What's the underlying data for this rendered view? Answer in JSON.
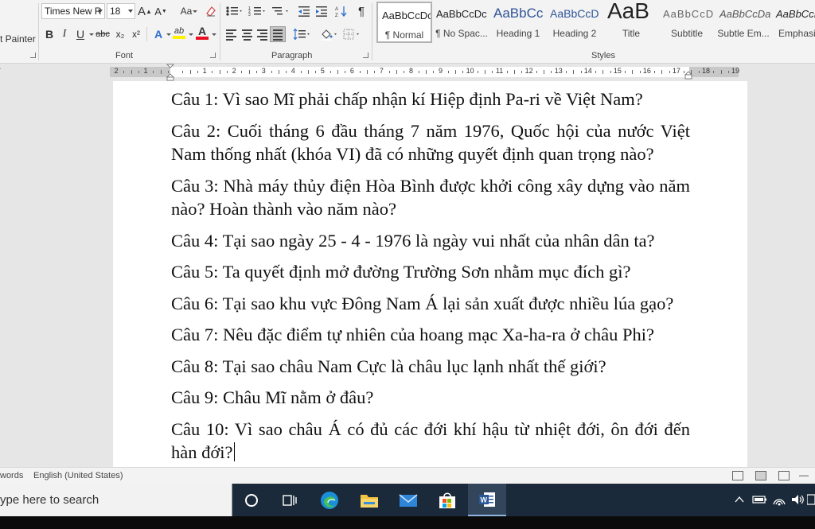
{
  "ribbon": {
    "format_painter_label": "t Painter",
    "font_group": {
      "label": "Font",
      "font_name": "Times New R",
      "font_size": "18",
      "grow_label": "A",
      "shrink_label": "A",
      "case_label": "Aa",
      "bold": "B",
      "italic": "I",
      "underline": "U",
      "strike": "abc",
      "subscript": "x₂",
      "superscript": "x²",
      "text_effects": "A",
      "highlight": "ab",
      "font_color": "A",
      "font_color_hex": "#e81123",
      "highlight_hex": "#fff200"
    },
    "paragraph_group": {
      "label": "Paragraph",
      "pilcrow": "¶"
    },
    "styles_group": {
      "label": "Styles",
      "items": [
        {
          "sample": "AaBbCcDc",
          "name": "¶ Normal",
          "selected": true
        },
        {
          "sample": "AaBbCcDc",
          "name": "¶ No Spac..."
        },
        {
          "sample": "AaBbCc",
          "name": "Heading 1"
        },
        {
          "sample": "AaBbCcD",
          "name": "Heading 2"
        },
        {
          "sample": "AaB",
          "name": "Title"
        },
        {
          "sample": "AaBbCcD",
          "name": "Subtitle"
        },
        {
          "sample": "AaBbCcDa",
          "name": "Subtle Em..."
        },
        {
          "sample": "AaBbCcD",
          "name": "Emphasi"
        }
      ]
    }
  },
  "ruler": {
    "numbers": [
      "2",
      "1",
      "",
      "1",
      "2",
      "3",
      "4",
      "5",
      "6",
      "7",
      "8",
      "9",
      "10",
      "11",
      "12",
      "13",
      "14",
      "15",
      "16",
      "17",
      "18",
      "19"
    ]
  },
  "document": {
    "paragraphs": [
      "Câu 1: Vì sao Mĩ phải chấp nhận kí Hiệp định Pa-ri về Việt Nam?",
      "Câu 2: Cuối tháng 6 đầu tháng 7 năm 1976, Quốc hội của nước Việt Nam thống nhất (khóa VI) đã có những quyết định quan trọng nào?",
      "Câu 3: Nhà máy thủy điện Hòa Bình được khởi công xây dựng vào năm nào? Hoàn thành vào năm nào?",
      "Câu 4: Tại sao ngày 25 - 4 - 1976 là ngày vui nhất của nhân dân ta?",
      "Câu 5: Ta quyết định mở đường Trường Sơn nhằm mục đích gì?",
      "Câu 6: Tại sao khu vực Đông Nam Á lại sản xuất được nhiều lúa gạo?",
      "Câu 7: Nêu đặc điểm tự nhiên của hoang mạc Xa-ha-ra ở châu Phi?",
      "Câu 8: Tại sao châu Nam Cực là châu lục lạnh nhất thế giới?",
      "Câu 9: Châu Mĩ nằm ở đâu?",
      "Câu 10: Vì sao châu Á có đủ các đới khí hậu từ nhiệt đới, ôn đới đến hàn đới?"
    ]
  },
  "statusbar": {
    "words": "words",
    "language": "English (United States)",
    "zoom_minus": "—"
  },
  "taskbar": {
    "search_placeholder": "ype here to search",
    "colors": {
      "accent": "#2b579a",
      "taskbar_bg": "#1b2a3a"
    }
  }
}
